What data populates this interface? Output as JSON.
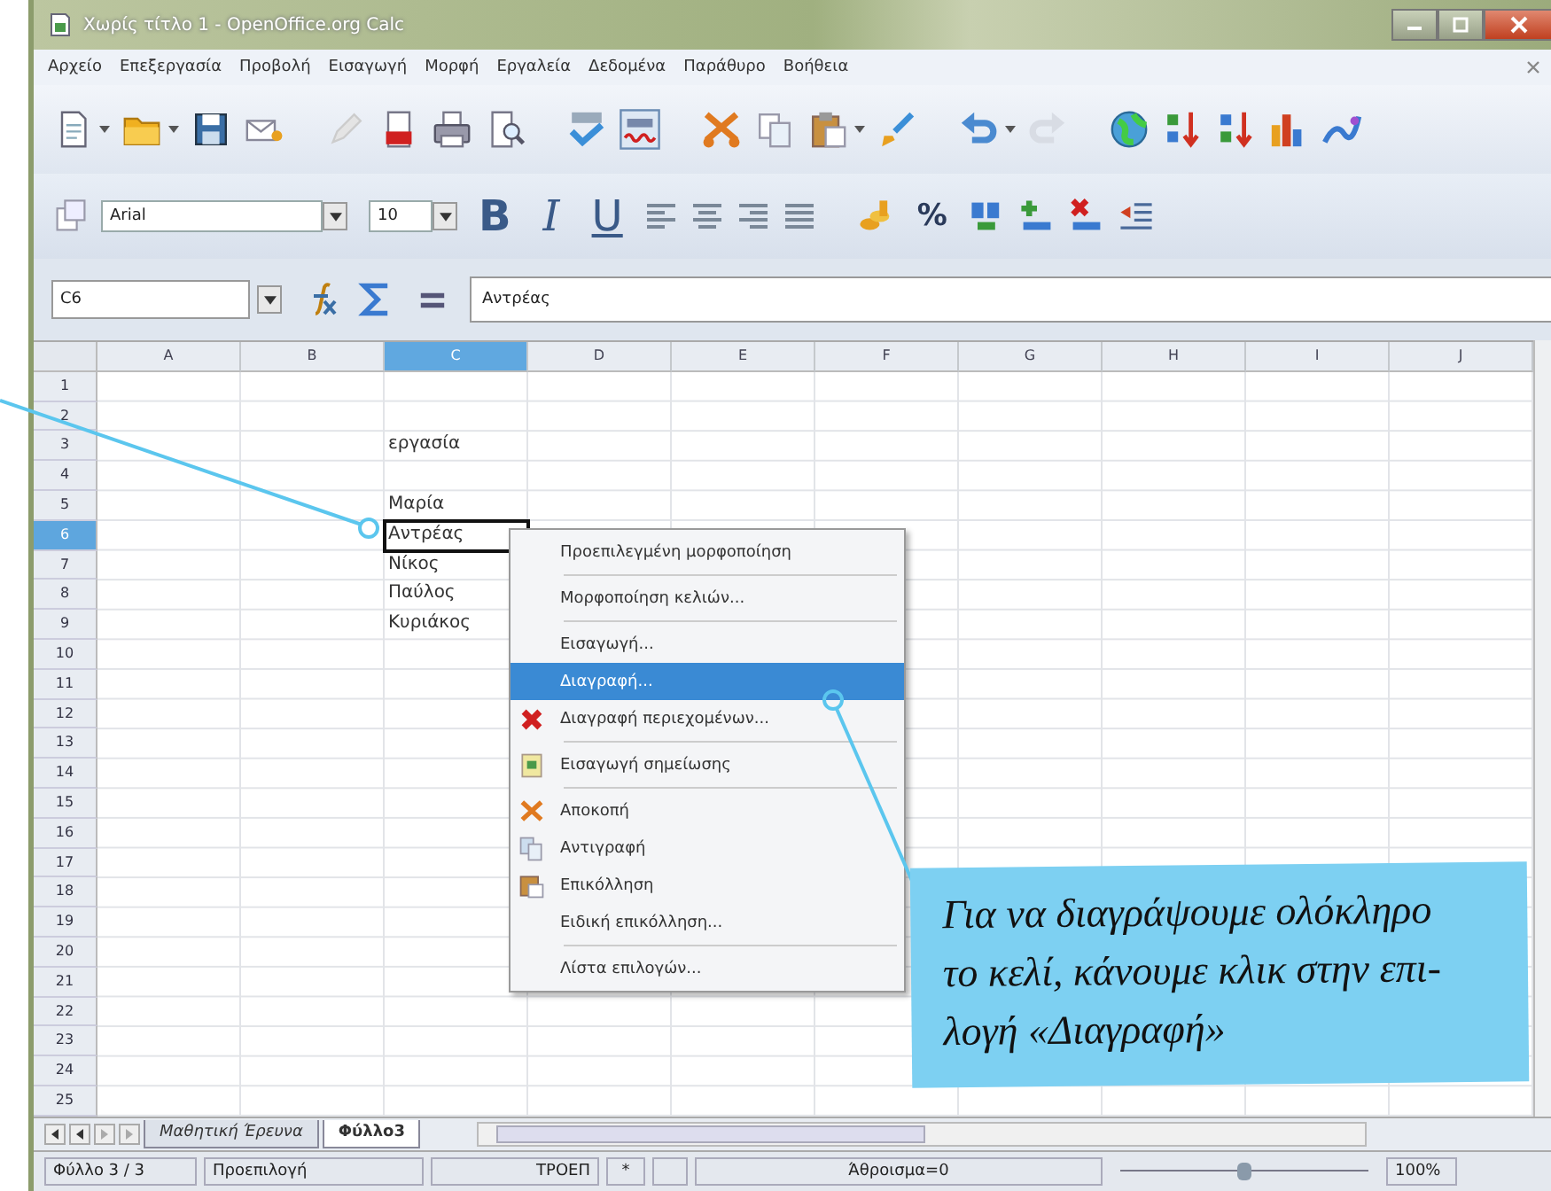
{
  "window": {
    "title": "Χωρίς τίτλο 1 - OpenOffice.org Calc"
  },
  "menu_bar": [
    "Αρχείο",
    "Επεξεργασία",
    "Προβολή",
    "Εισαγωγή",
    "Μορφή",
    "Εργαλεία",
    "Δεδομένα",
    "Παράθυρο",
    "Βοήθεια"
  ],
  "formatting_toolbar": {
    "font": "Arial",
    "size": "10",
    "style_buttons": [
      "B",
      "I",
      "U"
    ],
    "percent": "%"
  },
  "formula_bar": {
    "cell_reference": "C6",
    "content": "Αντρέας"
  },
  "columns": [
    {
      "label": "A",
      "selected": false
    },
    {
      "label": "B",
      "selected": false
    },
    {
      "label": "C",
      "selected": true
    },
    {
      "label": "D",
      "selected": false
    },
    {
      "label": "E",
      "selected": false
    },
    {
      "label": "F",
      "selected": false
    },
    {
      "label": "G",
      "selected": false
    },
    {
      "label": "H",
      "selected": false
    },
    {
      "label": "I",
      "selected": false
    },
    {
      "label": "J",
      "selected": false
    }
  ],
  "rows": [
    {
      "header": "1",
      "selected": false
    },
    {
      "header": "2",
      "selected": false
    },
    {
      "header": "3",
      "selected": false,
      "column_c": "εργασία"
    },
    {
      "header": "4",
      "selected": false
    },
    {
      "header": "5",
      "selected": false,
      "column_c": "Μαρία"
    },
    {
      "header": "6",
      "selected": true,
      "column_c": "Αντρέας"
    },
    {
      "header": "7",
      "selected": false,
      "column_c": "Νίκος"
    },
    {
      "header": "8",
      "selected": false,
      "column_c": "Παύλος"
    },
    {
      "header": "9",
      "selected": false,
      "column_c": "Κυριάκος"
    },
    {
      "header": "10",
      "selected": false
    },
    {
      "header": "11",
      "selected": false
    },
    {
      "header": "12",
      "selected": false
    },
    {
      "header": "13",
      "selected": false
    },
    {
      "header": "14",
      "selected": false
    },
    {
      "header": "15",
      "selected": false
    },
    {
      "header": "16",
      "selected": false
    },
    {
      "header": "17",
      "selected": false
    },
    {
      "header": "18",
      "selected": false
    },
    {
      "header": "19",
      "selected": false
    },
    {
      "header": "20",
      "selected": false
    },
    {
      "header": "21",
      "selected": false
    },
    {
      "header": "22",
      "selected": false
    },
    {
      "header": "23",
      "selected": false
    },
    {
      "header": "24",
      "selected": false
    },
    {
      "header": "25",
      "selected": false
    }
  ],
  "context_menu": {
    "sections": [
      {
        "items": [
          {
            "label": "Προεπιλεγμένη μορφοποίηση",
            "kind": "plain",
            "selected": false
          }
        ]
      },
      {
        "items": [
          {
            "label": "Μορφοποίηση κελιών...",
            "kind": "plain",
            "selected": false
          }
        ]
      },
      {
        "items": [
          {
            "label": "Εισαγωγή...",
            "kind": "plain",
            "selected": false
          },
          {
            "label": "Διαγραφή...",
            "kind": "plain",
            "selected": true
          },
          {
            "label": "Διαγραφή περιεχομένων...",
            "kind": "delete",
            "selected": false
          }
        ]
      },
      {
        "items": [
          {
            "label": "Εισαγωγή σημείωσης",
            "kind": "note",
            "selected": false
          }
        ]
      },
      {
        "items": [
          {
            "label": "Αποκοπή",
            "kind": "cut",
            "selected": false
          },
          {
            "label": "Αντιγραφή",
            "kind": "copy",
            "selected": false
          },
          {
            "label": "Επικόλληση",
            "kind": "paste",
            "selected": false
          },
          {
            "label": "Ειδική επικόλληση...",
            "kind": "plain",
            "selected": false
          }
        ]
      },
      {
        "items": [
          {
            "label": "Λίστα επιλογών...",
            "kind": "plain",
            "selected": false
          }
        ]
      }
    ]
  },
  "sheet_tabs": [
    {
      "label": "Μαθητική Έρευνα",
      "selected": false
    },
    {
      "label": "Φύλλο3",
      "selected": true
    }
  ],
  "status_bar": {
    "sheet": "Φύλλο 3 / 3",
    "style": "Προεπιλογή",
    "mode": "ΤΡΟΕΠ",
    "modified": "*",
    "sum": "Άθροισμα=0",
    "zoom": {
      "level": 0.5
    },
    "zoom_percent": "100%"
  },
  "callout": {
    "text": "Για να διαγράψουμε ολόκληρο\nτο κελί, κάνουμε κλικ στην επι-\nλογή «Διαγραφή»"
  }
}
